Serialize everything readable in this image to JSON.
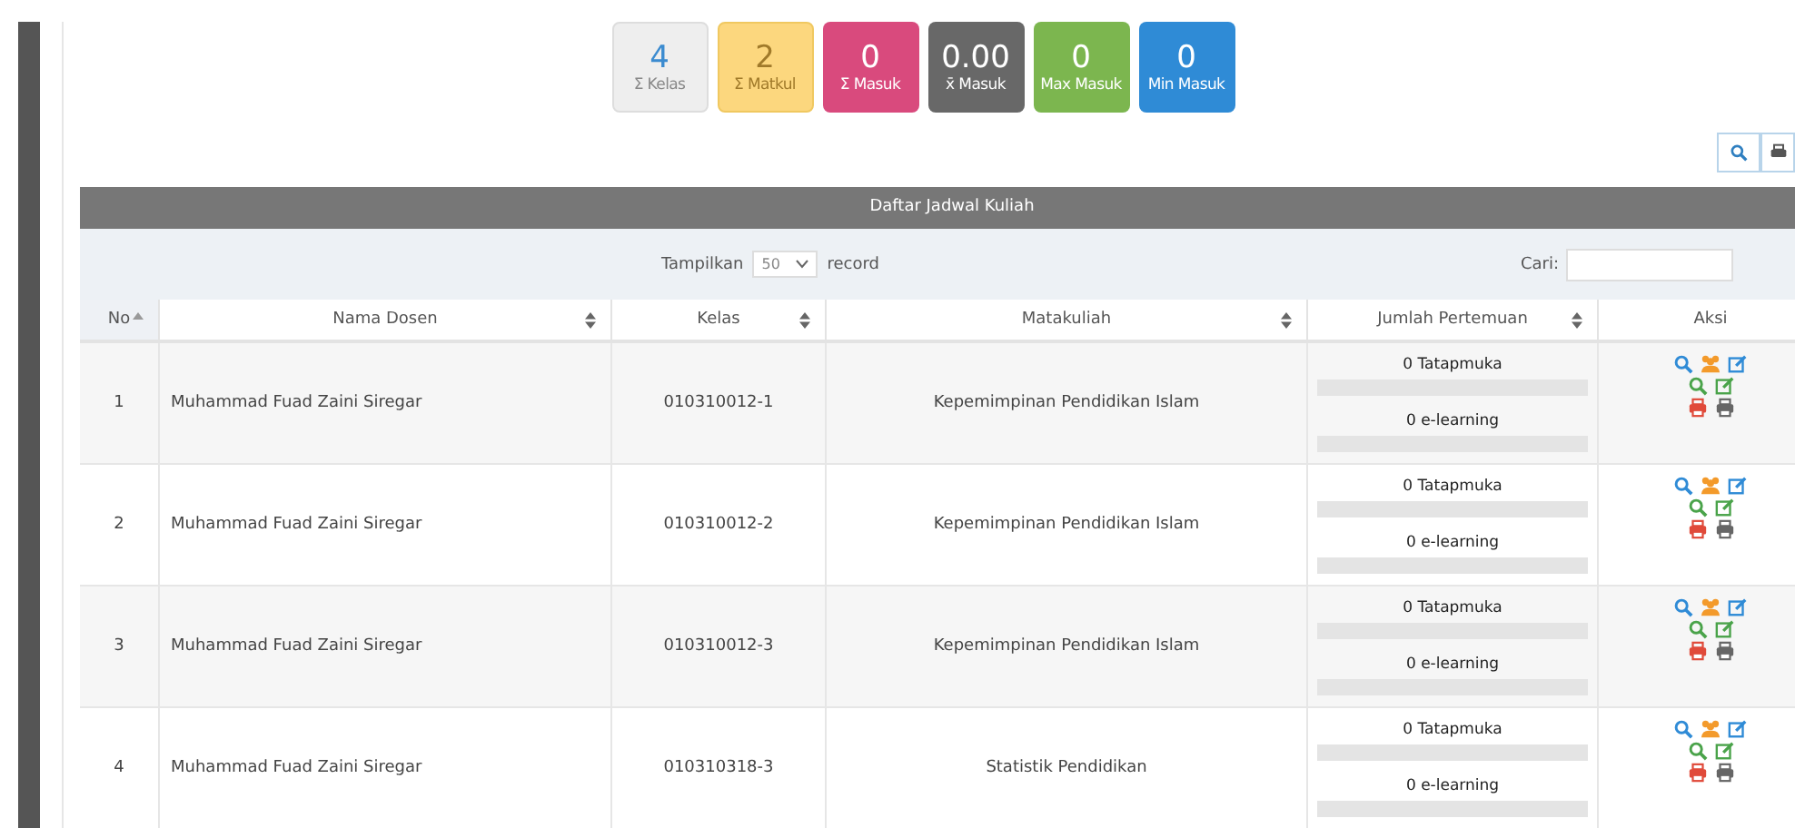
{
  "stats": [
    {
      "value": "4",
      "label": "Σ Kelas",
      "color": "#eeeeee"
    },
    {
      "value": "2",
      "label": "Σ Matkul",
      "color": "#fcd77e"
    },
    {
      "value": "0",
      "label": "Σ Masuk",
      "color": "#d94a7d"
    },
    {
      "value": "0.00",
      "label": "x̄ Masuk",
      "color": "#686868"
    },
    {
      "value": "0",
      "label": "Max Masuk",
      "color": "#7cb64f"
    },
    {
      "value": "0",
      "label": "Min Masuk",
      "color": "#2f8bd6"
    }
  ],
  "table": {
    "title": "Daftar Jadwal Kuliah",
    "length": {
      "prefix": "Tampilkan",
      "value": "50",
      "suffix": "record"
    },
    "search": {
      "label": "Cari:"
    },
    "columns": [
      {
        "label": "No",
        "kind": "ascending"
      },
      {
        "label": "Nama Dosen",
        "kind": "sortable"
      },
      {
        "label": "Kelas",
        "kind": "sortable"
      },
      {
        "label": "Matakuliah",
        "kind": "sortable"
      },
      {
        "label": "Jumlah Pertemuan",
        "kind": "sortable"
      },
      {
        "label": "Aksi",
        "kind": "plain"
      }
    ],
    "rows": [
      {
        "no": "1",
        "dosen": "Muhammad Fuad Zaini Siregar",
        "kelas": "010310012-1",
        "matakuliah": "Kepemimpinan Pendidikan Islam",
        "meetings": [
          {
            "text": "0 Tatapmuka",
            "level": 0
          },
          {
            "text": "0 e-learning",
            "level": 0
          }
        ]
      },
      {
        "no": "2",
        "dosen": "Muhammad Fuad Zaini Siregar",
        "kelas": "010310012-2",
        "matakuliah": "Kepemimpinan Pendidikan Islam",
        "meetings": [
          {
            "text": "0 Tatapmuka",
            "level": 0
          },
          {
            "text": "0 e-learning",
            "level": 0
          }
        ]
      },
      {
        "no": "3",
        "dosen": "Muhammad Fuad Zaini Siregar",
        "kelas": "010310012-3",
        "matakuliah": "Kepemimpinan Pendidikan Islam",
        "meetings": [
          {
            "text": "0 Tatapmuka",
            "level": 0
          },
          {
            "text": "0 e-learning",
            "level": 0
          }
        ]
      },
      {
        "no": "4",
        "dosen": "Muhammad Fuad Zaini Siregar",
        "kelas": "010310318-3",
        "matakuliah": "Statistik Pendidikan",
        "meetings": [
          {
            "text": "0 Tatapmuka",
            "level": 0
          },
          {
            "text": "0 e-learning",
            "level": 0
          }
        ]
      }
    ]
  }
}
